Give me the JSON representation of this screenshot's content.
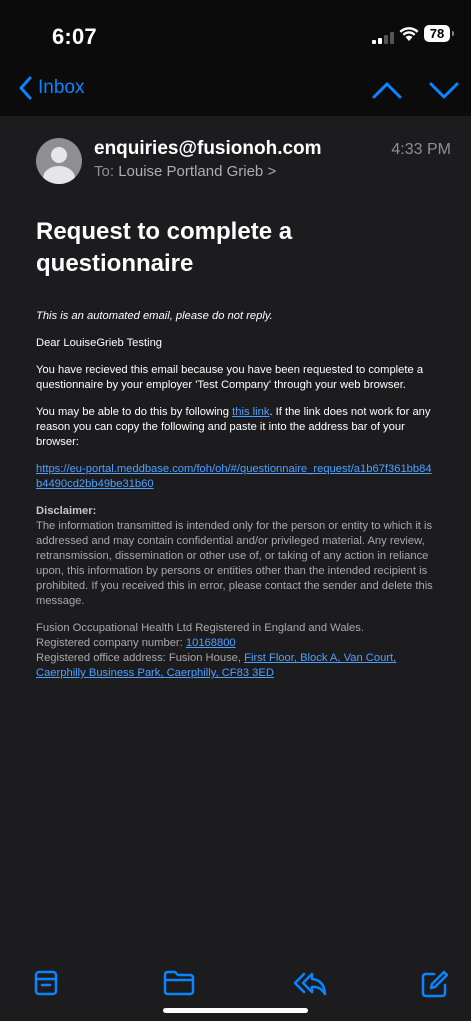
{
  "status_bar": {
    "time": "6:07",
    "battery": "78",
    "signal_bars": 2
  },
  "nav": {
    "back_label": "Inbox"
  },
  "email": {
    "sender": "enquiries@fusionoh.com",
    "time": "4:33 PM",
    "to_label": "To:",
    "to_name": "Louise Portland Grieb >",
    "subject": "Request to complete a questionnaire",
    "automated_note": "This is an automated email, please do not reply.",
    "greeting": "Dear LouiseGrieb Testing",
    "para1": "You have recieved this email because you have been requested to complete a questionnaire by your employer 'Test Company' through your web browser.",
    "para2_before": "You may be able to do this by following ",
    "para2_link": "this link",
    "para2_after": ". If the link does not work for any reason you can copy the following and paste it into the address bar of your browser:",
    "url": "https://eu-portal.meddbase.com/foh/oh/#/questionnaire_request/a1b67f361bb84b4490cd2bb49be31b60",
    "disclaimer_heading": "Disclaimer:",
    "disclaimer_text": "The information transmitted is intended only for the person or entity to which it is addressed and may contain confidential and/or privileged material. Any review, retransmission, dissemination or other use of, or taking of any action in reliance upon, this information by persons or entities other than the intended recipient is prohibited. If you received this in error, please contact the sender and delete this message.",
    "footer_line1": "Fusion Occupational Health Ltd Registered in England and Wales.",
    "footer_reg_label": "Registered company number: ",
    "footer_reg_number": "10168800",
    "footer_addr_before": "Registered office address: Fusion House, ",
    "footer_addr_link": "First Floor, Block A, Van Court, Caerphilly Business Park, Caerphilly, CF83 3ED"
  },
  "toolbar": {
    "icons": [
      "archive-icon",
      "folder-icon",
      "reply-icon",
      "compose-icon"
    ]
  },
  "colors": {
    "accent": "#0a84ff",
    "link": "#4ea0ff",
    "background": "#1c1c1e"
  }
}
